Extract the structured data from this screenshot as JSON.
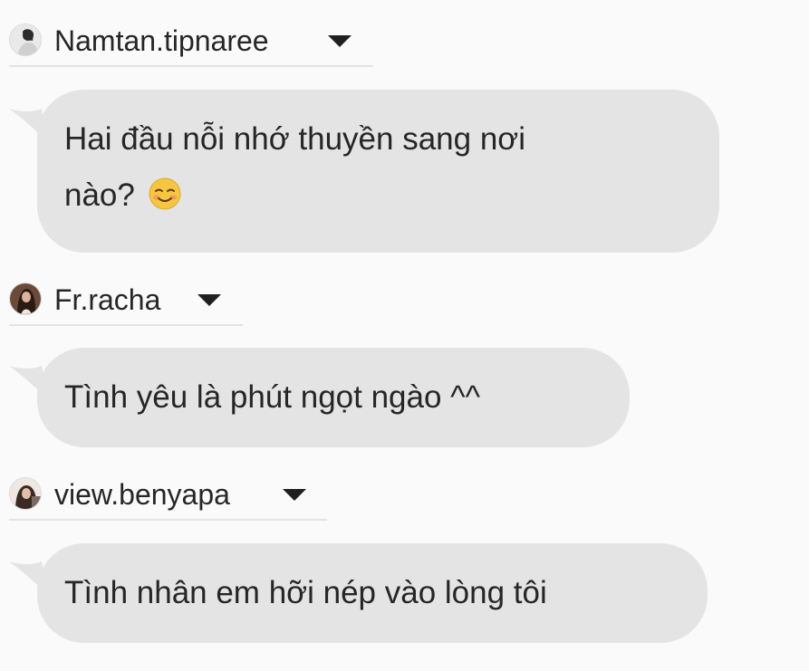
{
  "messages": [
    {
      "username": "Namtan.tipnaree",
      "lines": [
        "Hai đầu nỗi nhớ thuyền sang nơi",
        "nào?"
      ],
      "emoji": "smiling-face-icon"
    },
    {
      "username": "Fr.racha",
      "lines": [
        "Tình yêu là phút ngọt ngào ^^"
      ]
    },
    {
      "username": "view.benyapa",
      "lines": [
        "Tình nhân em hỡi nép vào lòng tôi"
      ]
    }
  ],
  "colors": {
    "background": "#fafafa",
    "bubble": "#e4e4e4",
    "text": "#262626",
    "divider": "#e3e3e3"
  }
}
